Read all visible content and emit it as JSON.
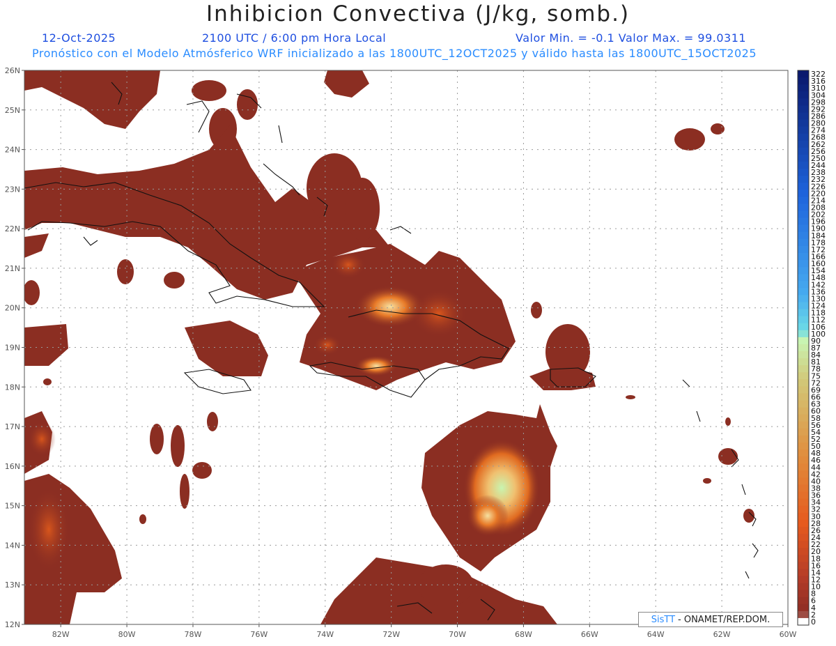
{
  "header": {
    "title": "Inhibicion Convectiva (J/kg, somb.)",
    "date": "12-Oct-2025",
    "time": "2100 UTC / 6:00 pm Hora Local",
    "minmax": "Valor Min. = -0.1  Valor Max. = 99.0311",
    "description": "Pronóstico con el Modelo Atmósferico WRF inicializado a las 1800UTC_12OCT2025 y válido hasta las  1800UTC_15OCT2025"
  },
  "map": {
    "lon_range": [
      -83.1,
      -60.0
    ],
    "lat_range": [
      12.0,
      26.0
    ],
    "lon_ticks": [
      "82W",
      "80W",
      "78W",
      "76W",
      "74W",
      "72W",
      "70W",
      "68W",
      "66W",
      "64W",
      "62W",
      "60W"
    ],
    "lat_ticks": [
      "12N",
      "13N",
      "14N",
      "15N",
      "16N",
      "17N",
      "18N",
      "19N",
      "20N",
      "21N",
      "22N",
      "23N",
      "24N",
      "25N",
      "26N"
    ],
    "grid": "dotted",
    "field_color": "#8b2e22",
    "highlight_color": "#c8f5b0"
  },
  "colorbar": {
    "labels": [
      "322",
      "316",
      "310",
      "304",
      "298",
      "292",
      "286",
      "280",
      "274",
      "268",
      "262",
      "256",
      "250",
      "244",
      "238",
      "232",
      "226",
      "220",
      "214",
      "208",
      "202",
      "196",
      "190",
      "184",
      "178",
      "172",
      "166",
      "160",
      "154",
      "148",
      "142",
      "136",
      "130",
      "124",
      "118",
      "112",
      "106",
      "100",
      "90",
      "87",
      "84",
      "81",
      "78",
      "75",
      "72",
      "69",
      "66",
      "63",
      "60",
      "58",
      "56",
      "54",
      "52",
      "50",
      "48",
      "46",
      "44",
      "42",
      "40",
      "38",
      "36",
      "34",
      "32",
      "30",
      "28",
      "26",
      "24",
      "22",
      "20",
      "18",
      "16",
      "14",
      "12",
      "10",
      "8",
      "6",
      "4",
      "2",
      "0"
    ]
  },
  "credit": {
    "brand": "SisTT",
    "text": "- ONAMET/REP.DOM."
  }
}
